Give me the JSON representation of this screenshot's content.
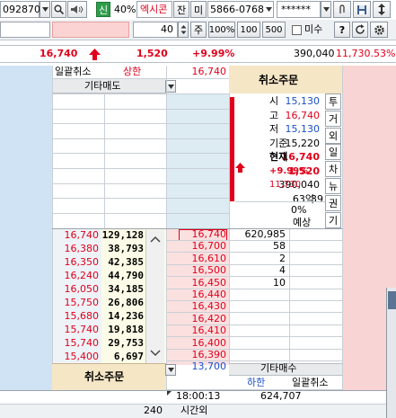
{
  "toolbar": {
    "code": "092870",
    "ratio_label": "신",
    "ratio_value": "40%",
    "name": "엑시콘",
    "btn_jan": "잔",
    "btn_mi": "미",
    "account": "5866-0768",
    "password": "******"
  },
  "toolbar2": {
    "quantity": "40",
    "unit": "주",
    "pct": "100%",
    "q100": "100",
    "q500": "500",
    "misu": "미수",
    "help": "?"
  },
  "summary": {
    "price": "16,740",
    "change": "1,520",
    "rate": "+9.99%",
    "volume": "390,040",
    "amount": "11,730.53%"
  },
  "header_row": {
    "cancel_all": "일괄취소",
    "upper": "상한",
    "upper_price": "16,740",
    "other_sell": "기타매도"
  },
  "info": {
    "title": "취소주문",
    "rows": [
      {
        "value": "15,130",
        "label": "시"
      },
      {
        "value": "16,740",
        "label": "고"
      },
      {
        "value": "15,130",
        "label": "저"
      },
      {
        "value": "15,220",
        "label": "기준"
      },
      {
        "value": "16,740",
        "label": "현재"
      },
      {
        "value": "1,520",
        "label": "+9.99%"
      },
      {
        "value": "390,040",
        "label": "11,730"
      },
      {
        "value": "63억",
        "label": "39"
      }
    ],
    "pct": "0%",
    "expect": "예상"
  },
  "side_tabs": [
    "투",
    "거",
    "외",
    "일",
    "차",
    "뉴",
    "권",
    "기"
  ],
  "ticks": [
    {
      "price": "16,740",
      "vol": "129,128"
    },
    {
      "price": "16,380",
      "vol": "38,793"
    },
    {
      "price": "16,350",
      "vol": "42,385"
    },
    {
      "price": "16,240",
      "vol": "44,790"
    },
    {
      "price": "16,050",
      "vol": "34,185"
    },
    {
      "price": "15,750",
      "vol": "26,806"
    },
    {
      "price": "15,680",
      "vol": "14,236"
    },
    {
      "price": "15,740",
      "vol": "19,818"
    },
    {
      "price": "15,740",
      "vol": "29,753"
    },
    {
      "price": "15,400",
      "vol": "6,697"
    }
  ],
  "bid_prices": [
    "16,740",
    "16,700",
    "16,610",
    "16,500",
    "16,450",
    "16,440",
    "16,430",
    "16,420",
    "16,410",
    "16,400",
    "16,390",
    "13,700"
  ],
  "bid_qty": [
    "620,985",
    "58",
    "2",
    "4",
    "10"
  ],
  "bottom": {
    "cancel_order": "취소주문",
    "other_buy": "기타매수",
    "lower": "하한",
    "cancel_all": "일괄취소",
    "time": "18:00:13",
    "total": "624,707",
    "qty240": "240",
    "after_hours": "시간외"
  },
  "colors": {
    "ask_bg": "#cfe3f5",
    "bid_bg": "#f9d4d4",
    "up": "#e0001b",
    "down": "#1a4fc9"
  }
}
